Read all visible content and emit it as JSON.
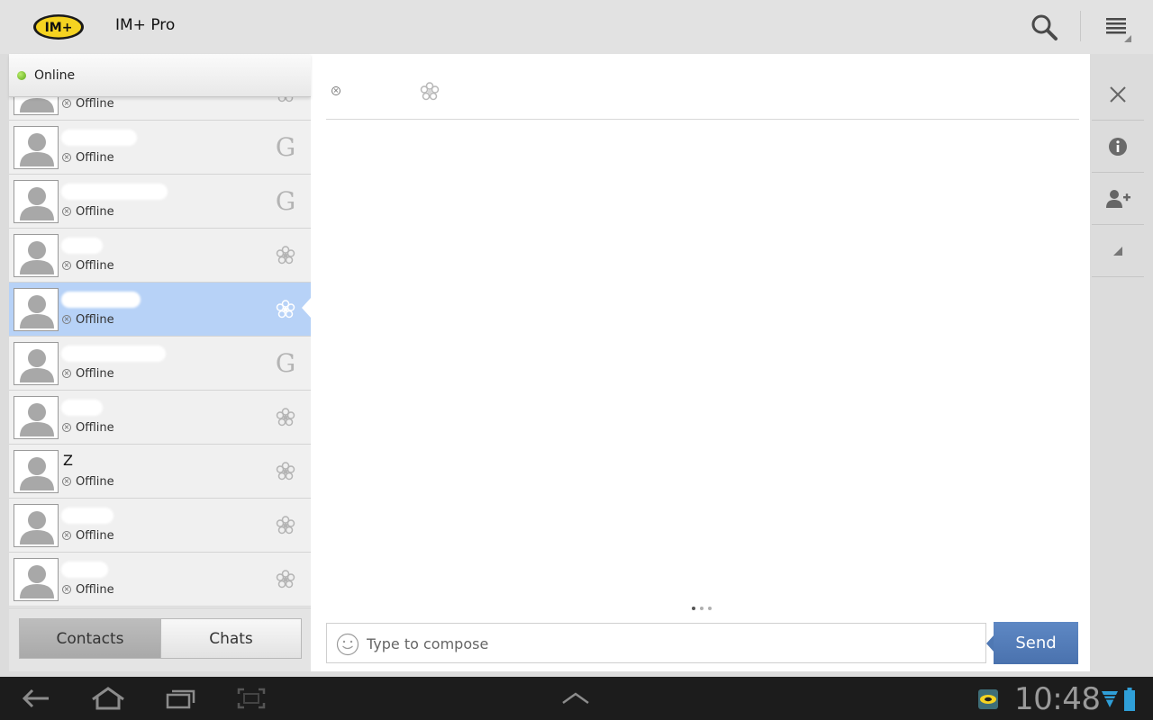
{
  "app": {
    "title": "IM+ Pro",
    "logo_text": "IM+"
  },
  "status": {
    "label": "Online",
    "color": "#6dbb2a"
  },
  "contacts": [
    {
      "name": "",
      "status": "Offline",
      "service": "icq-flower-icon",
      "avatar_cut": true
    },
    {
      "name": "",
      "status": "Offline",
      "service": "google-talk-icon"
    },
    {
      "name": "",
      "status": "Offline",
      "service": "google-talk-icon"
    },
    {
      "name": "",
      "status": "Offline",
      "service": "icq-flower-icon"
    },
    {
      "name": "",
      "status": "Offline",
      "service": "icq-flower-icon",
      "selected": true
    },
    {
      "name": "",
      "status": "Offline",
      "service": "google-talk-icon"
    },
    {
      "name": "",
      "status": "Offline",
      "service": "icq-flower-icon"
    },
    {
      "name": "Z",
      "status": "Offline",
      "service": "icq-flower-icon"
    },
    {
      "name": "",
      "status": "Offline",
      "service": "icq-flower-icon"
    },
    {
      "name": "",
      "status": "Offline",
      "service": "icq-flower-icon"
    }
  ],
  "tabs": {
    "contacts": "Contacts",
    "chats": "Chats",
    "active": "contacts"
  },
  "chat": {
    "contact_status": "Offline",
    "compose_placeholder": "Type to compose",
    "send_label": "Send",
    "page_count": 3,
    "active_page": 0
  },
  "right_actions": [
    "close-icon",
    "info-icon",
    "add-contact-icon",
    "expand-corner-icon"
  ],
  "system_bar": {
    "time": "10:48",
    "buttons": [
      "back-icon",
      "home-icon",
      "recent-apps-icon",
      "screenshot-icon",
      "chevron-up-icon"
    ]
  },
  "colors": {
    "selected_row": "#b7d2f7",
    "send_button": "#4f78b3",
    "system_bar": "#1c1c1c"
  }
}
